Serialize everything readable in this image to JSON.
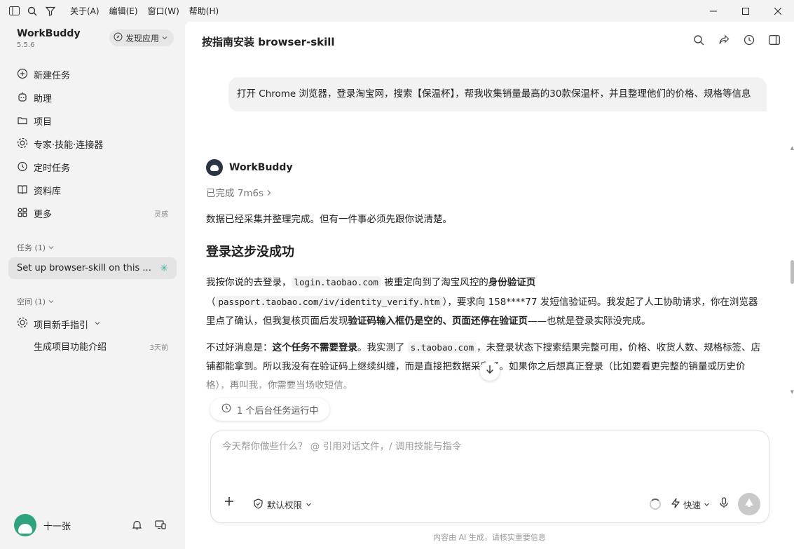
{
  "menus": [
    "关于(A)",
    "编辑(E)",
    "窗口(W)",
    "帮助(H)"
  ],
  "sidebar": {
    "brand_name": "WorkBuddy",
    "brand_version": "5.5.6",
    "discover_label": "发现应用",
    "nav_items": [
      {
        "label": "新建任务",
        "icon": "plus-circle-icon"
      },
      {
        "label": "助理",
        "icon": "assistant-icon"
      },
      {
        "label": "项目",
        "icon": "project-icon"
      },
      {
        "label": "专家·技能·连接器",
        "icon": "expert-icon"
      },
      {
        "label": "定时任务",
        "icon": "clock-icon"
      },
      {
        "label": "资料库",
        "icon": "book-icon"
      },
      {
        "label": "更多",
        "icon": "grid-icon",
        "tag": "灵感"
      }
    ],
    "tasks_section": "任务 (1)",
    "active_task": "Set up browser-skill on this ...",
    "spaces_section": "空间 (1)",
    "project_label": "项目新手指引",
    "sub_item_label": "生成项目功能介绍",
    "sub_item_time": "3天前",
    "user_name": "十一张"
  },
  "main": {
    "title": "按指南安装 browser-skill",
    "user_message": "打开 Chrome 浏览器，登录淘宝网，搜索【保温杯】，帮我收集销量最高的30款保温杯，并且整理他们的价格、规格等信息",
    "bot_name": "WorkBuddy",
    "done_label": "已完成 7m6s",
    "para1": "数据已经采集并整理完成。但有一件事必须先跟你说清楚。",
    "heading": "登录这步没成功",
    "para2": {
      "t1": "我按你说的去登录，",
      "code1": "login.taobao.com",
      "t2": " 被重定向到了淘宝风控的",
      "b1": "身份验证页",
      "t3": "（",
      "code2": "passport.taobao.com/iv/identity_verify.htm",
      "t4": "），要求向 158****77 发短信验证码。我发起了人工协助请求，你在浏览器里点了确认，但我复核页面后发现",
      "b2": "验证码输入框仍是空的、页面还停在验证页",
      "t5": "——也就是登录实际没完成。"
    },
    "para3": {
      "t1": "不过好消息是：",
      "b1": "这个任务不需要登录",
      "t2": "。我实测了 ",
      "code1": "s.taobao.com",
      "t3": "，未登录状态下搜索结果完整可用，价格、收货人数、规格标签、店铺都能拿到。所以我没有在验证码上继续纠缠，而是直接把数据采完了。如果你之后想真正登录（比如要看更完整的销量或历史价格），再叫我，你需要当场收短信。"
    },
    "bg_task_label": "1 个后台任务运行中",
    "composer_placeholder": "今天帮你做些什么？ @ 引用对话文件，/ 调用技能与指令",
    "permission_label": "默认权限",
    "speed_label": "快速",
    "footer": "内容由 AI 生成，请核实重要信息"
  }
}
